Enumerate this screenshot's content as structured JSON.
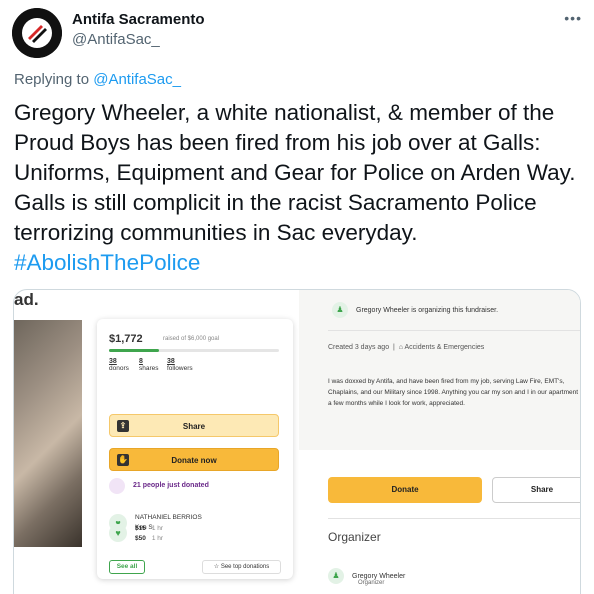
{
  "tweet": {
    "display_name": "Antifa Sacramento",
    "handle": "@AntifaSac_",
    "more_icon": "ellipsis-icon",
    "replying_to_prefix": "Replying to ",
    "replying_to_handle": "@AntifaSac_",
    "text": "Gregory Wheeler, a white nationalist, & member of the Proud Boys has been fired from his job over at Galls: Uniforms, Equipment and Gear for Police on Arden Way. Galls is still complicit in the racist Sacramento Police terrorizing communities in Sac everyday.",
    "hashtag": "#AbolishThePolice",
    "link_color": "#1d9bf0"
  },
  "screenshot": {
    "cut_text": "ad.",
    "card": {
      "raised_amount": "$1,772",
      "raised_sub": "raised of $6,000 goal",
      "progress_fraction": 0.295,
      "stats": [
        {
          "value": "38",
          "label": "donors"
        },
        {
          "value": "8",
          "label": "shares"
        },
        {
          "value": "38",
          "label": "followers"
        }
      ],
      "share_label": "Share",
      "donate_label": "Donate now",
      "recent_text": "21 people just donated",
      "donors": [
        {
          "name": "NATHANIEL BERRIOS",
          "amount": "$15",
          "time": "1 hr"
        },
        {
          "name": "Ken S",
          "amount": "$50",
          "time": "1 hr"
        }
      ],
      "see_all_label": "See all",
      "see_top_label": "☆ See top donations"
    },
    "panel": {
      "organizing_text": "Gregory Wheeler is organizing this fundraiser.",
      "created_text": "Created 3 days ago",
      "category": "Accidents & Emergencies",
      "description": "I was doxxed by Antifa, and have been fired from my job, serving Law Fire, EMT's, Chaplains, and our Military since 1998. Anything you car my son and I in our apartment for a few months while I look for work, appreciated.",
      "donate_label": "Donate",
      "share_label": "Share",
      "organizer_heading": "Organizer",
      "organizer_name": "Gregory Wheeler",
      "organizer_role": "Organizer",
      "accent_green": "#3fa54d",
      "accent_orange": "#f8b93a"
    }
  }
}
